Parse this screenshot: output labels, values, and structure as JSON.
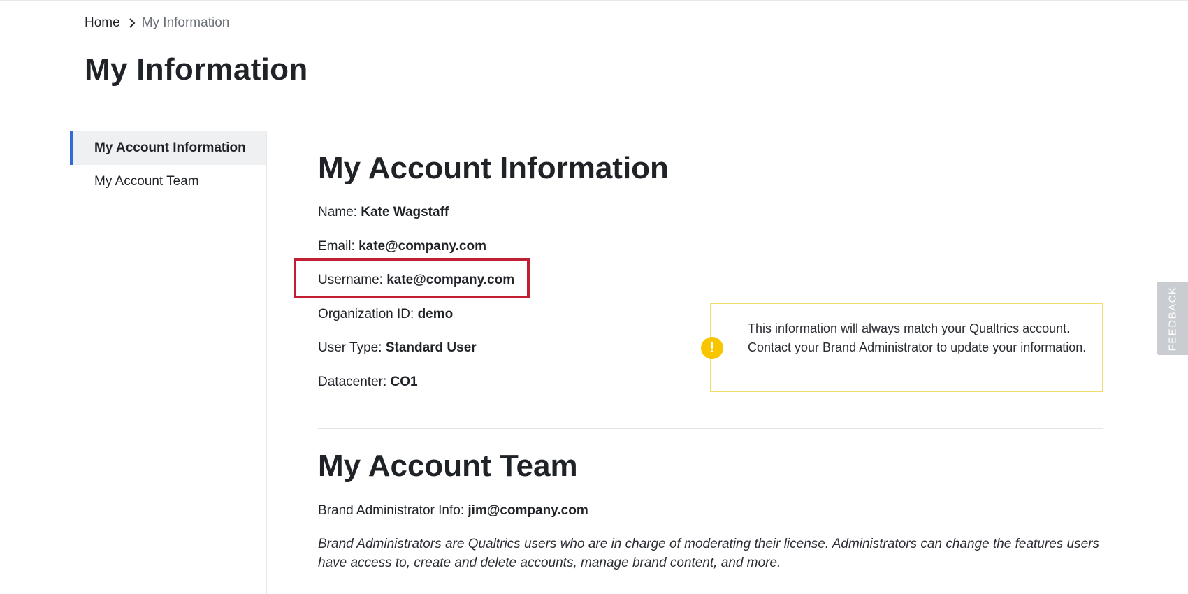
{
  "breadcrumb": {
    "home": "Home",
    "current": "My Information"
  },
  "page": {
    "title": "My Information"
  },
  "sidebar": {
    "items": [
      {
        "label": "My Account Information",
        "active": true
      },
      {
        "label": "My Account Team",
        "active": false
      }
    ]
  },
  "account": {
    "title": "My Account Information",
    "name_label": "Name:",
    "name_value": "Kate Wagstaff",
    "email_label": "Email:",
    "email_value": "kate@company.com",
    "username_label": "Username:",
    "username_value": "kate@company.com",
    "org_label": "Organization ID:",
    "org_value": "demo",
    "usertype_label": "User Type:",
    "usertype_value": "Standard User",
    "datacenter_label": "Datacenter:",
    "datacenter_value": "CO1"
  },
  "notice": {
    "icon": "!",
    "text": "This information will always match your Qualtrics account. Contact your Brand Administrator to update your information."
  },
  "team": {
    "title": "My Account Team",
    "admin_label": "Brand Administrator Info:",
    "admin_value": "jim@company.com",
    "description": "Brand Administrators are Qualtrics users who are in charge of moderating their license. Administrators can change the features users have access to, create and delete accounts, manage brand content, and more."
  },
  "feedback": {
    "label": "FEEDBACK"
  },
  "colors": {
    "accent": "#2f6cd8",
    "highlight": "#c01f33",
    "notice_border": "#f2dc6b",
    "warning_icon": "#f7c600"
  }
}
